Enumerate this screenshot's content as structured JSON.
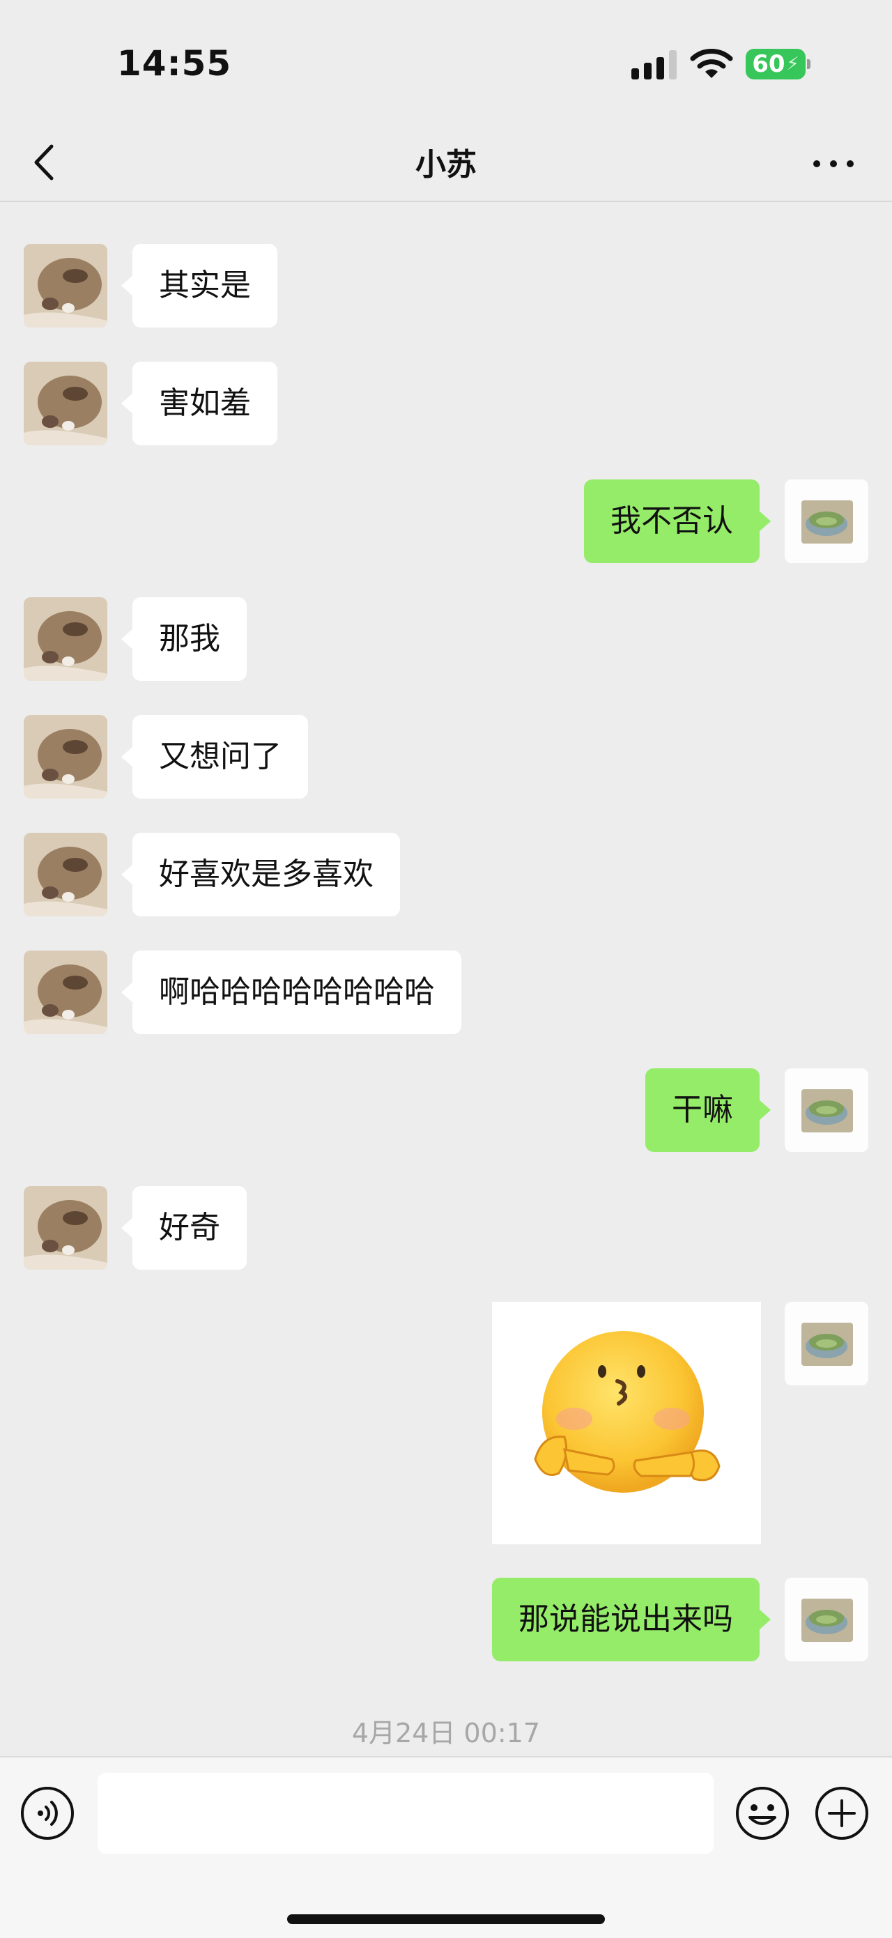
{
  "status_bar": {
    "time": "14:55",
    "battery": "60",
    "icons": [
      "signal-icon",
      "wifi-icon",
      "battery-charging-icon"
    ]
  },
  "nav": {
    "title": "小苏",
    "back_icon": "chevron-left-icon",
    "more_icon": "more-dots-icon"
  },
  "messages": [
    {
      "side": "left",
      "type": "text",
      "text": "其实是"
    },
    {
      "side": "left",
      "type": "text",
      "text": "害如羞"
    },
    {
      "side": "right",
      "type": "text",
      "text": "我不否认"
    },
    {
      "side": "left",
      "type": "text",
      "text": "那我"
    },
    {
      "side": "left",
      "type": "text",
      "text": "又想问了"
    },
    {
      "side": "left",
      "type": "text",
      "text": "好喜欢是多喜欢"
    },
    {
      "side": "left",
      "type": "text",
      "text": "啊哈哈哈哈哈哈哈哈"
    },
    {
      "side": "right",
      "type": "text",
      "text": "干嘛"
    },
    {
      "side": "left",
      "type": "text",
      "text": "好奇"
    },
    {
      "side": "right",
      "type": "sticker",
      "sticker": "shy-emoji-sticker"
    },
    {
      "side": "right",
      "type": "text",
      "text": "那说能说出来吗"
    }
  ],
  "timestamp": "4月24日 00:17",
  "input_bar": {
    "text_value": "",
    "voice_icon": "voice-icon",
    "emoji_icon": "emoji-icon",
    "plus_icon": "plus-icon"
  },
  "colors": {
    "background": "#ededed",
    "sent_bubble": "#95ec69",
    "received_bubble": "#ffffff",
    "battery": "#37c65a"
  }
}
